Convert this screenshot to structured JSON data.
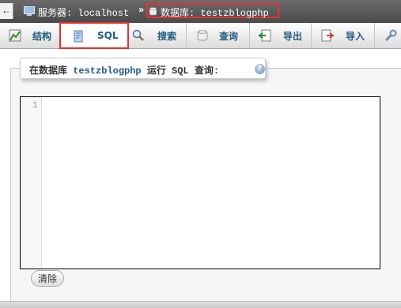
{
  "breadcrumb": {
    "back": "←",
    "server_label": "服务器: localhost",
    "separator": "»",
    "database_label": "数据库: testzblogphp"
  },
  "tabs": [
    {
      "label": "结构",
      "icon": "structure-icon"
    },
    {
      "label": "SQL",
      "icon": "sql-icon",
      "active": true
    },
    {
      "label": "搜索",
      "icon": "search-icon"
    },
    {
      "label": "查询",
      "icon": "query-icon"
    },
    {
      "label": "导出",
      "icon": "export-icon"
    },
    {
      "label": "导入",
      "icon": "import-icon"
    },
    {
      "label": "",
      "icon": "wrench-icon"
    }
  ],
  "sql_panel": {
    "legend_prefix": "在数据库 ",
    "database": "testzblogphp",
    "legend_suffix": " 运行 SQL 查询:",
    "help": "?",
    "line_number": "1",
    "clear_button": "清除"
  },
  "colors": {
    "highlight": "#e8302e",
    "link": "#235a81"
  }
}
